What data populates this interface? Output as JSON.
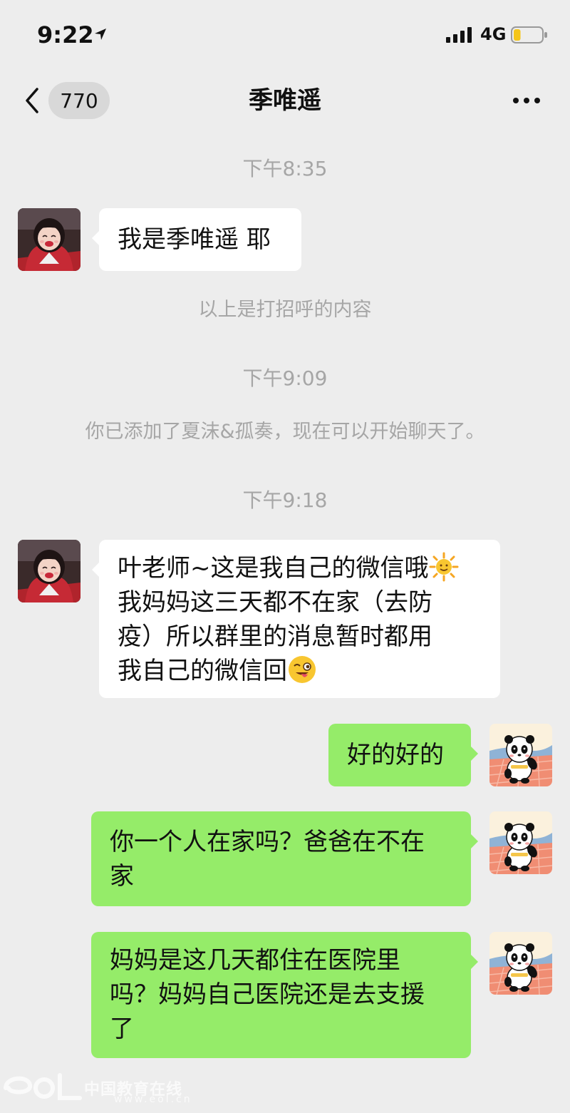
{
  "status_bar": {
    "time": "9:22",
    "network": "4G",
    "battery_level": 0.25
  },
  "nav": {
    "unread_count": "770",
    "title": "季唯遥"
  },
  "messages": [
    {
      "type": "time",
      "text": "下午8:35"
    },
    {
      "type": "incoming",
      "text": "我是季唯遥 耶"
    },
    {
      "type": "system",
      "text": "以上是打招呼的内容"
    },
    {
      "type": "time",
      "text": "下午9:09"
    },
    {
      "type": "system",
      "text": "你已添加了夏沫&孤奏，现在可以开始聊天了。"
    },
    {
      "type": "time",
      "text": "下午9:18"
    },
    {
      "type": "incoming",
      "lines": [
        "叶老师~这是我自己的微信哦",
        "我妈妈这三天都不在家（去防",
        "疫）所以群里的消息暂时都用",
        "我自己的微信回"
      ],
      "emojis": [
        "sun-emoji",
        "winking-tongue-emoji"
      ]
    },
    {
      "type": "outgoing",
      "text": "好的好的"
    },
    {
      "type": "outgoing",
      "lines": [
        "你一个人在家吗？爸爸在不在",
        "家"
      ]
    },
    {
      "type": "outgoing",
      "lines": [
        "妈妈是这几天都住在医院里",
        "吗？妈妈自己医院还是去支援",
        "了"
      ]
    }
  ],
  "watermark": {
    "logo": "eol",
    "text": "中国教育在线",
    "url": "www.eol.cn"
  },
  "colors": {
    "background": "#ededed",
    "incoming_bubble": "#ffffff",
    "outgoing_bubble": "#95ec69",
    "system_text": "#a6a6a6"
  }
}
